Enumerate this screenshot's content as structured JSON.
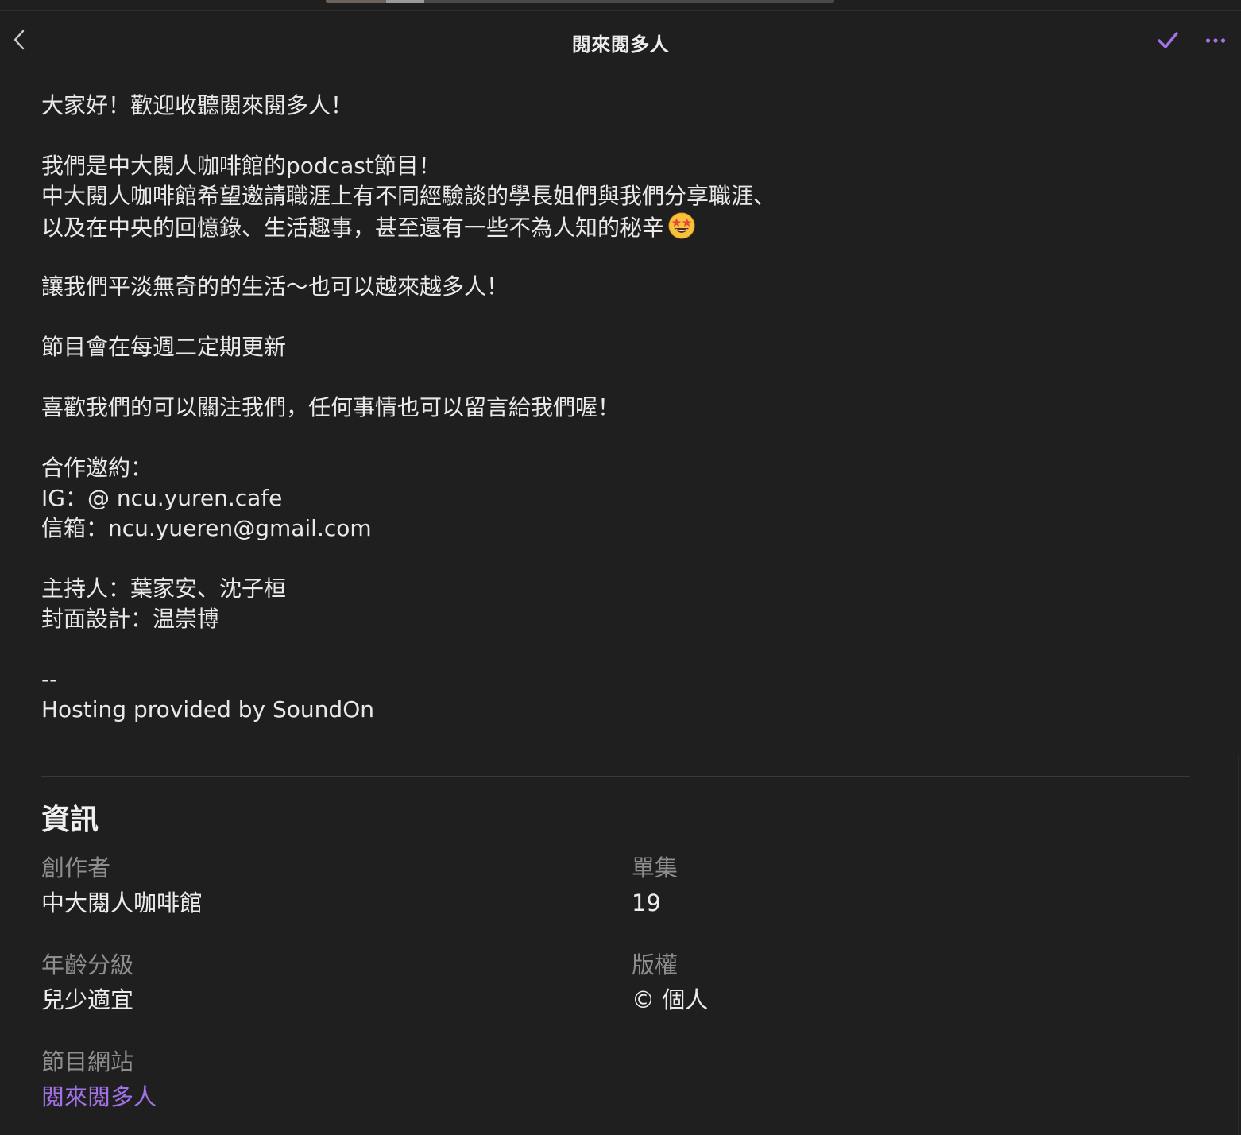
{
  "header": {
    "title": "閱來閱多人",
    "back_icon": "chevron-left-icon",
    "check_icon": "checkmark-icon",
    "more_icon": "ellipsis-icon",
    "accent_color": "#a472e8"
  },
  "description": {
    "paragraphs": [
      [
        "大家好！歡迎收聽閱來閱多人！"
      ],
      [
        "我們是中大閱人咖啡館的podcast節目！",
        "中大閱人咖啡館希望邀請職涯上有不同經驗談的學長姐們與我們分享職涯、",
        "以及在中央的回憶錄、生活趣事，甚至還有一些不為人知的秘辛"
      ],
      [
        "讓我們平淡無奇的的生活～也可以越來越多人！"
      ],
      [
        "節目會在每週二定期更新"
      ],
      [
        "喜歡我們的可以關注我們，任何事情也可以留言給我們喔！"
      ],
      [
        "合作邀約：",
        "IG：@ ncu.yuren.cafe",
        "信箱：ncu.yueren@gmail.com"
      ],
      [
        "主持人：葉家安、沈子桓",
        "封面設計：温崇博"
      ],
      [
        "--",
        "Hosting provided by SoundOn"
      ]
    ],
    "emoji_icon": "star-struck-emoji-icon"
  },
  "info": {
    "title": "資訊",
    "creator_label": "創作者",
    "creator_value": "中大閱人咖啡館",
    "episodes_label": "單集",
    "episodes_value": "19",
    "rating_label": "年齡分級",
    "rating_value": "兒少適宜",
    "copyright_label": "版權",
    "copyright_value": "© 個人",
    "website_label": "節目網站",
    "website_value": "閱來閱多人"
  }
}
